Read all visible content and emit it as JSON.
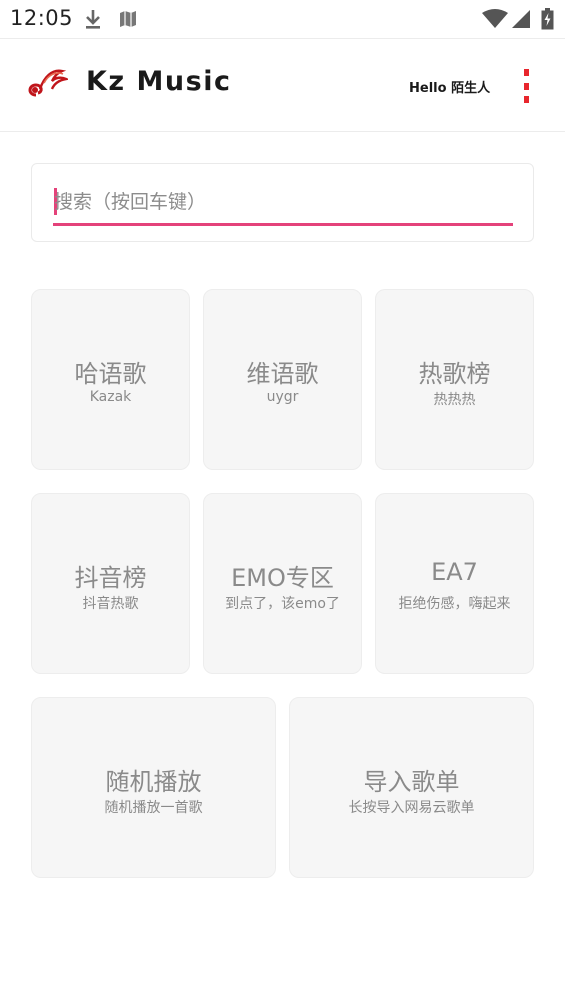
{
  "status_bar": {
    "time": "12:05",
    "icons": [
      "download-icon",
      "map-icon",
      "wifi-icon",
      "cellular-icon",
      "battery-charging-icon"
    ]
  },
  "app_bar": {
    "title": "Kz Music",
    "greeting": "Hello 陌生人",
    "logo_icon": "music-note-logo-icon",
    "menu_icon": "more-vertical-icon",
    "accent_color": "#e8262d"
  },
  "search": {
    "placeholder": "搜索（按回车键）",
    "value": "",
    "accent_color": "#e4427a"
  },
  "categories": [
    {
      "title": "哈语歌",
      "subtitle": "Kazak"
    },
    {
      "title": "维语歌",
      "subtitle": "uygr"
    },
    {
      "title": "热歌榜",
      "subtitle": "热热热"
    },
    {
      "title": "抖音榜",
      "subtitle": "抖音热歌"
    },
    {
      "title": "EMO专区",
      "subtitle": "到点了，该emo了"
    },
    {
      "title": "EA7",
      "subtitle": "拒绝伤感，嗨起来"
    },
    {
      "title": "随机播放",
      "subtitle": "随机播放一首歌"
    },
    {
      "title": "导入歌单",
      "subtitle": "长按导入网易云歌单"
    }
  ]
}
